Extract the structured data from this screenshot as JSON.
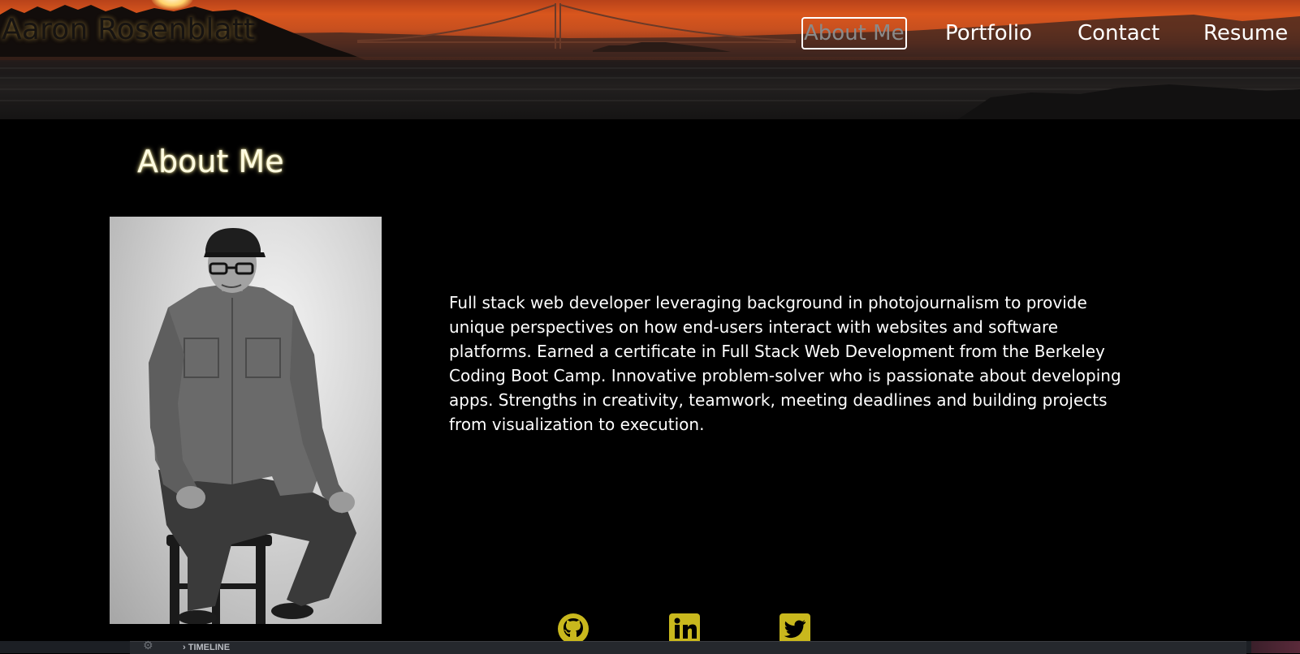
{
  "site": {
    "brand": "Aaron Rosenblatt"
  },
  "nav": {
    "items": [
      {
        "label": "About Me",
        "active": true
      },
      {
        "label": "Portfolio",
        "active": false
      },
      {
        "label": "Contact",
        "active": false
      },
      {
        "label": "Resume",
        "active": false
      }
    ]
  },
  "about": {
    "title": "About Me",
    "bio": "Full stack web developer leveraging background in photojournalism to provide unique perspectives on how end-users interact with websites and software platforms. Earned a certificate in Full Stack Web Development from the Berkeley Coding Boot Camp. Innovative problem-solver who is passionate about developing apps. Strengths in creativity, teamwork, meeting deadlines and building projects from visualization to execution."
  },
  "social": {
    "icons": [
      "github-icon",
      "linkedin-icon",
      "twitter-icon"
    ],
    "color": "#c9b81d"
  },
  "underlying_window": {
    "panel_label": "TIMELINE"
  }
}
